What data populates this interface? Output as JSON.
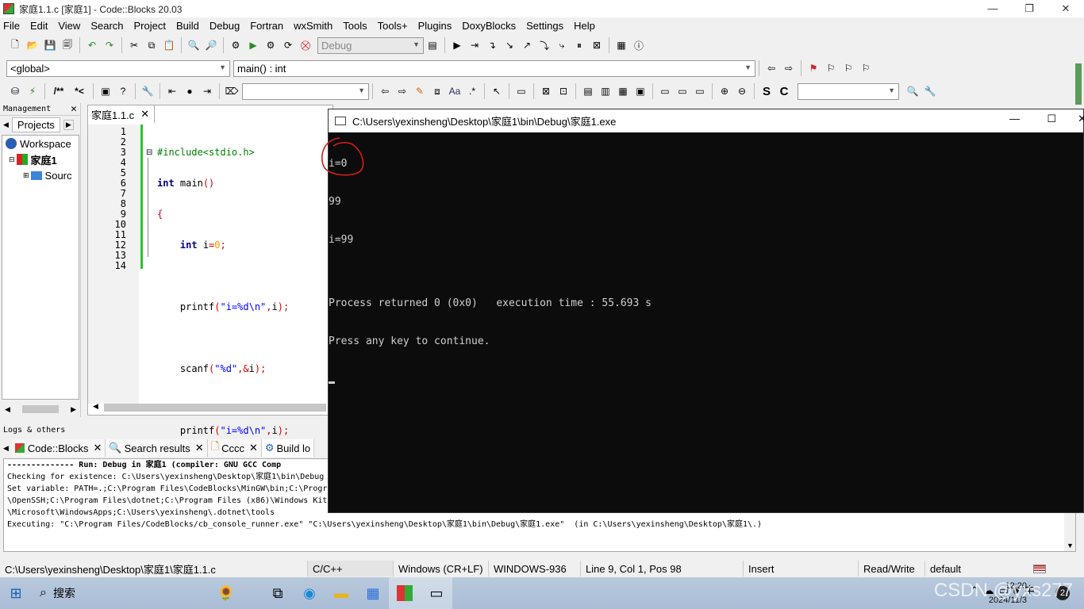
{
  "window": {
    "title": "家庭1.1.c [家庭1] - Code::Blocks 20.03"
  },
  "menu": [
    "File",
    "Edit",
    "View",
    "Search",
    "Project",
    "Build",
    "Debug",
    "Fortran",
    "wxSmith",
    "Tools",
    "Tools+",
    "Plugins",
    "DoxyBlocks",
    "Settings",
    "Help"
  ],
  "toolbar": {
    "build_target": "Debug",
    "scope": "<global>",
    "function": "main() : int"
  },
  "management": {
    "header": "Management",
    "tab": "Projects",
    "tree": {
      "workspace": "Workspace",
      "project": "家庭1",
      "sources": "Sourc"
    }
  },
  "editor": {
    "tab_label": "家庭1.1.c",
    "line_numbers": [
      "1",
      "2",
      "3",
      "4",
      "5",
      "6",
      "7",
      "8",
      "9",
      "10",
      "11",
      "12",
      "13",
      "14"
    ]
  },
  "console": {
    "title": "C:\\Users\\yexinsheng\\Desktop\\家庭1\\bin\\Debug\\家庭1.exe",
    "lines": [
      "i=0",
      "99",
      "i=99",
      "",
      "Process returned 0 (0x0)   execution time : 55.693 s",
      "Press any key to continue."
    ]
  },
  "logs": {
    "header": "Logs & others",
    "tabs": [
      "Code::Blocks",
      "Search results",
      "Cccc",
      "Build lo"
    ],
    "lines": [
      "-------------- Run: Debug in 家庭1 (compiler: GNU GCC Comp",
      "Checking for existence: C:\\Users\\yexinsheng\\Desktop\\家庭1\\bin\\Debug",
      "Set variable: PATH=.;C:\\Program Files\\CodeBlocks\\MinGW\\bin;C:\\Progra",
      "\\OpenSSH;C:\\Program Files\\dotnet;C:\\Program Files (x86)\\Windows Kit",
      "\\Microsoft\\WindowsApps;C:\\Users\\yexinsheng\\.dotnet\\tools",
      "Executing: \"C:\\Program Files/CodeBlocks/cb_console_runner.exe\" \"C:\\Users\\yexinsheng\\Desktop\\家庭1\\bin\\Debug\\家庭1.exe\"  (in C:\\Users\\yexinsheng\\Desktop\\家庭1\\.)"
    ]
  },
  "status": {
    "path": "C:\\Users\\yexinsheng\\Desktop\\家庭1\\家庭1.1.c",
    "lang": "C/C++",
    "eol": "Windows (CR+LF)",
    "encoding": "WINDOWS-936",
    "position": "Line 9, Col 1, Pos 98",
    "mode": "Insert",
    "rw": "Read/Write",
    "profile": "default"
  },
  "taskbar": {
    "search": "搜索",
    "watermark": "CSDN @yxs277",
    "time": "12:20",
    "date": "2024/11/3"
  }
}
